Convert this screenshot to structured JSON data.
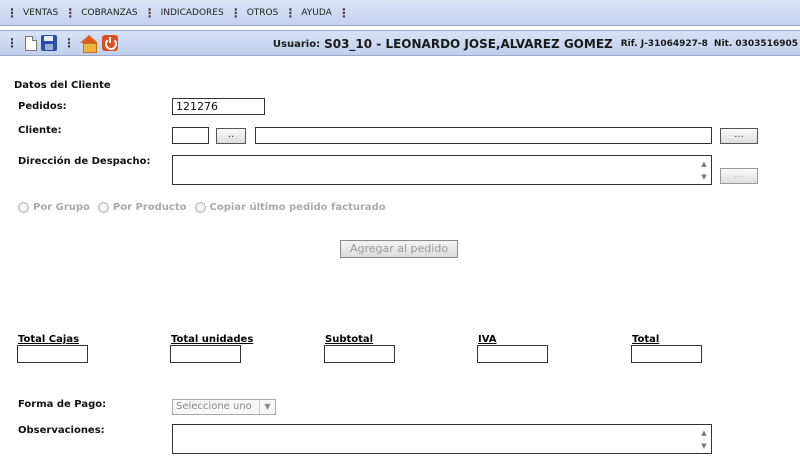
{
  "menu": {
    "items": [
      "VENTAS",
      "COBRANZAS",
      "INDICADORES",
      "OTROS",
      "AYUDA"
    ]
  },
  "toolbar": {
    "icons": [
      "new-document-icon",
      "save-icon",
      "home-icon",
      "exit-icon"
    ],
    "usuario_label": "Usuario:",
    "usuario_name": "S03_10 - LEONARDO JOSE,ALVAREZ GOMEZ",
    "rif": "Rif. J-31064927-8",
    "nit": "Nit. 0303516905"
  },
  "form": {
    "section_title": "Datos del Cliente",
    "pedidos_label": "Pedidos:",
    "pedidos_value": "121276",
    "cliente_label": "Cliente:",
    "cliente_code": "",
    "cliente_name": "",
    "small_dots_button": "..",
    "dots_button": "...",
    "direccion_label": "Dirección de Despacho:",
    "direccion_value": "",
    "radio_por_grupo": "Por Grupo",
    "radio_por_producto": "Por Producto",
    "radio_copiar": "Copiar último pedido facturado",
    "agregar_button": "Agregar al pedido"
  },
  "totals": {
    "cajas_label": "Total Cajas",
    "unidades_label": "Total unidades",
    "subtotal_label": "Subtotal",
    "iva_label": "IVA",
    "total_label": "Total",
    "cajas_value": "",
    "unidades_value": "",
    "subtotal_value": "",
    "iva_value": "",
    "total_value": ""
  },
  "payment": {
    "forma_label": "Forma de Pago:",
    "forma_selected": "Seleccione uno",
    "observaciones_label": "Observaciones:",
    "observaciones_value": ""
  },
  "colors": {
    "bar_top": "#d9e3f5",
    "bar_bottom": "#c4d3ee",
    "accent_orange": "#e04d1f"
  }
}
